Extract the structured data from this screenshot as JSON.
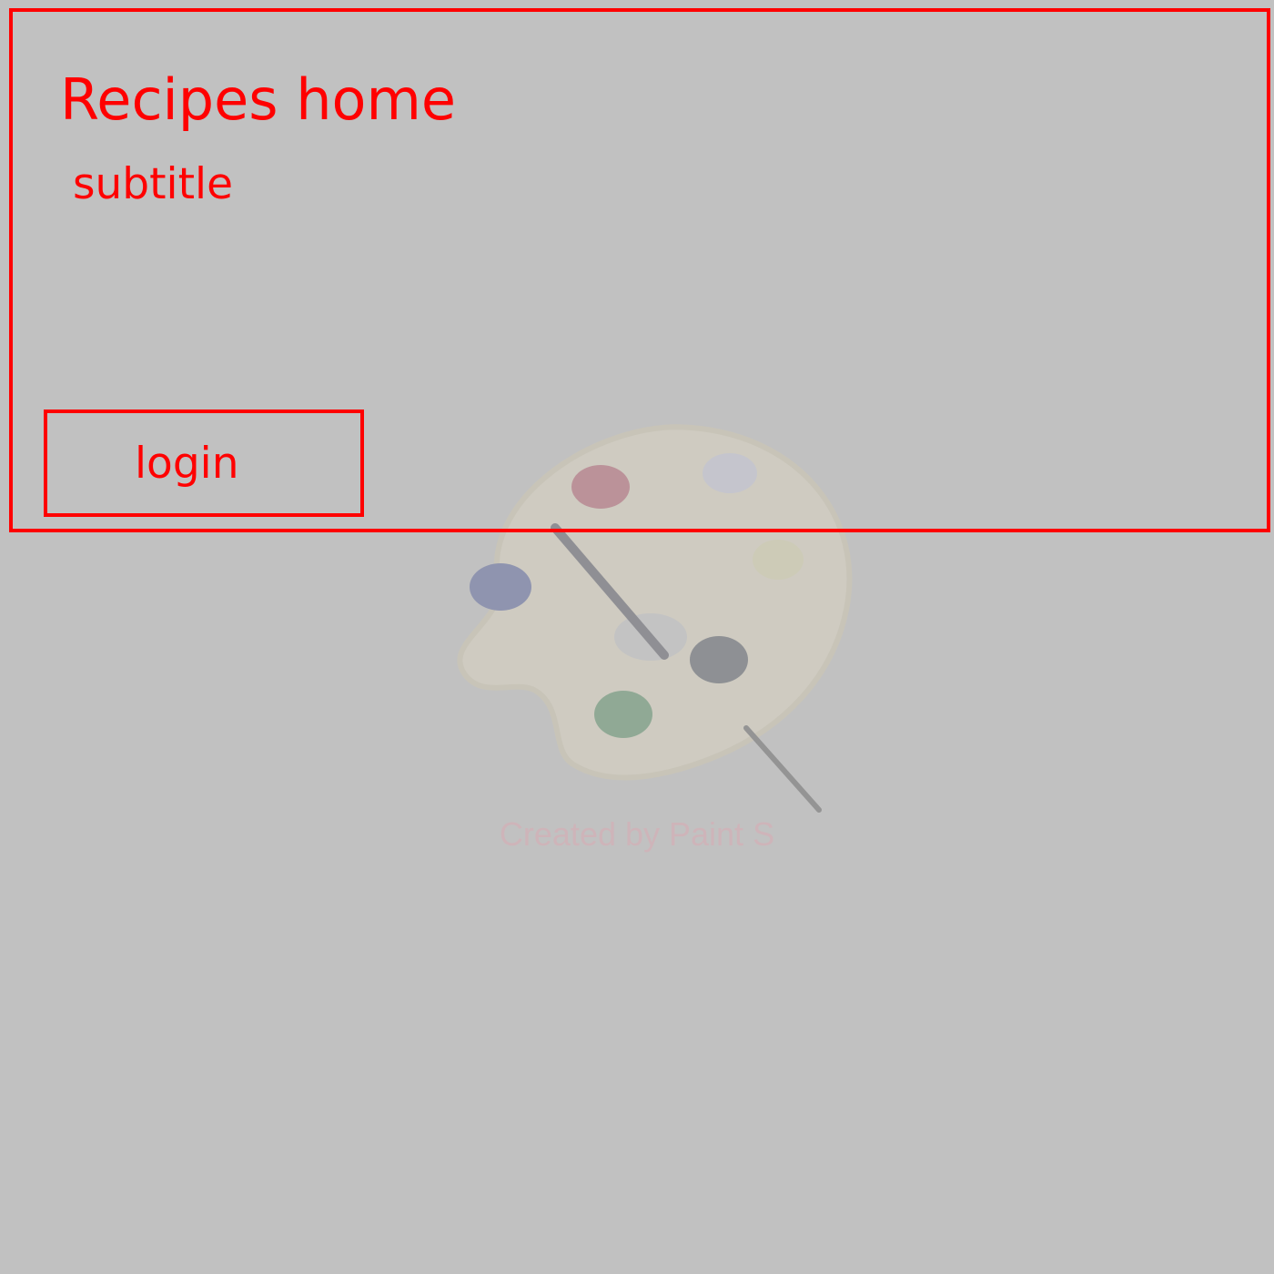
{
  "header": {
    "title": "Recipes home",
    "subtitle": "subtitle"
  },
  "actions": {
    "login_label": "login"
  },
  "watermark": {
    "caption": "Created by Paint S",
    "icon": "paint-palette-icon"
  },
  "colors": {
    "background": "#c1c1c1",
    "accent": "#ff0000",
    "watermark_text": "#d6aeb5"
  }
}
